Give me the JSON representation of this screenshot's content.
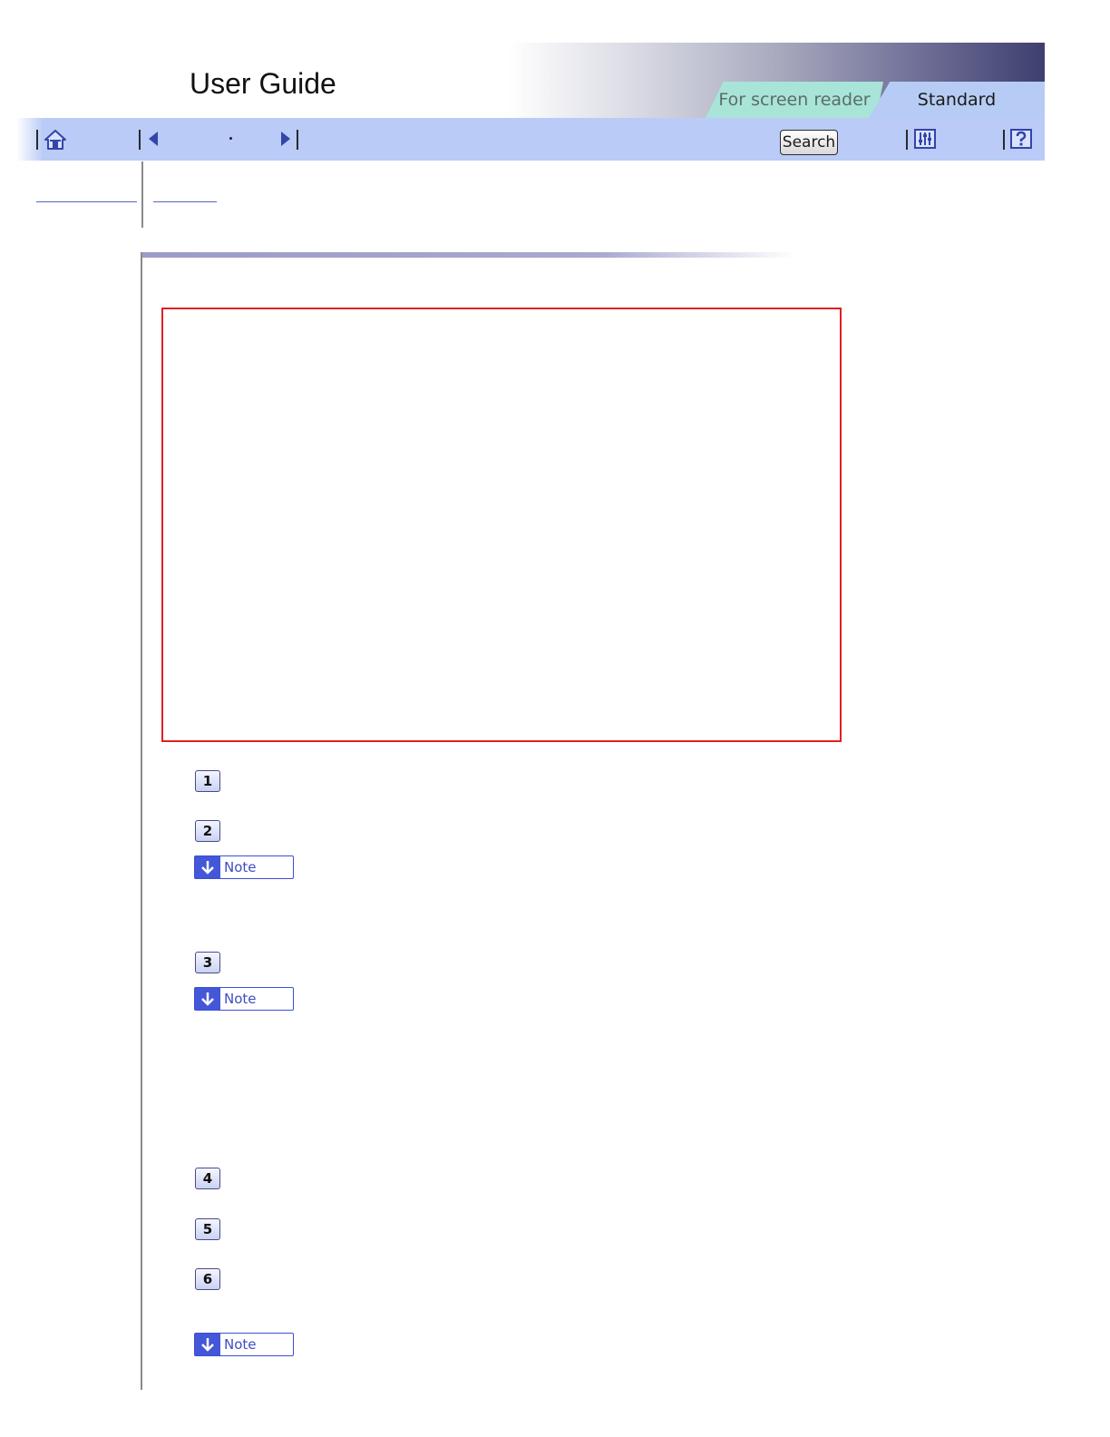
{
  "header": {
    "title": "User Guide",
    "tabs": [
      {
        "label": "For screen reader"
      },
      {
        "label": "Standard",
        "active": true
      }
    ]
  },
  "toolbar": {
    "search_label": "Search",
    "icons": [
      "home-icon",
      "previous-icon",
      "next-icon",
      "settings-icon",
      "help-icon"
    ]
  },
  "steps": [
    {
      "number": "1"
    },
    {
      "number": "2",
      "note": "Note"
    },
    {
      "number": "3",
      "note": "Note"
    },
    {
      "number": "4"
    },
    {
      "number": "5"
    },
    {
      "number": "6",
      "note": "Note"
    }
  ],
  "colors": {
    "toolbar": "#b9cbf6",
    "tab_standard": "#b6ccf4",
    "tab_screen_reader": "#a8e4d8",
    "figure_border": "#e02020",
    "note_accent": "#4457d8"
  }
}
